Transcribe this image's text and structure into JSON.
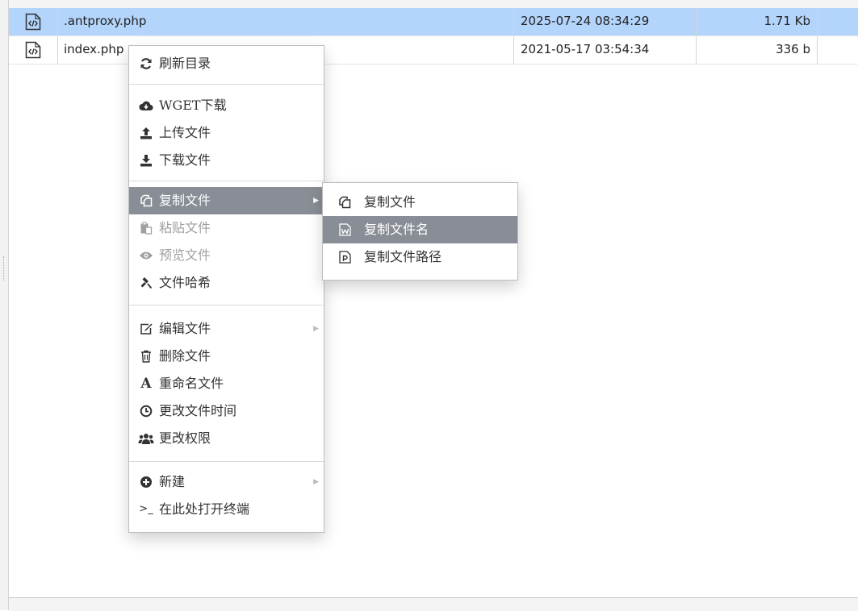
{
  "files": [
    {
      "name": ".antproxy.php",
      "modified": "2025-07-24 08:34:29",
      "size": "1.71 Kb",
      "icon": "php-file-icon",
      "selected": true
    },
    {
      "name": "index.php",
      "modified": "2021-05-17 03:54:34",
      "size": "336 b",
      "icon": "php-file-icon",
      "selected": false
    }
  ],
  "context_menu": {
    "refresh": "刷新目录",
    "wget": "WGET下载",
    "upload": "上传文件",
    "download": "下载文件",
    "copy": "复制文件",
    "paste": "粘贴文件",
    "preview": "预览文件",
    "hash": "文件哈希",
    "edit": "编辑文件",
    "delete": "删除文件",
    "rename": "重命名文件",
    "change_time": "更改文件时间",
    "permissions": "更改权限",
    "new": "新建",
    "terminal": "在此处打开终端",
    "rename_icon_text": "A",
    "terminal_icon_text": ">_"
  },
  "copy_submenu": {
    "copy_file": "复制文件",
    "copy_filename": "复制文件名",
    "copy_filepath": "复制文件路径"
  },
  "colors": {
    "selected_row": "#b3d4fb",
    "menu_highlight": "#898e96",
    "disabled_text": "#a0a0a0"
  }
}
